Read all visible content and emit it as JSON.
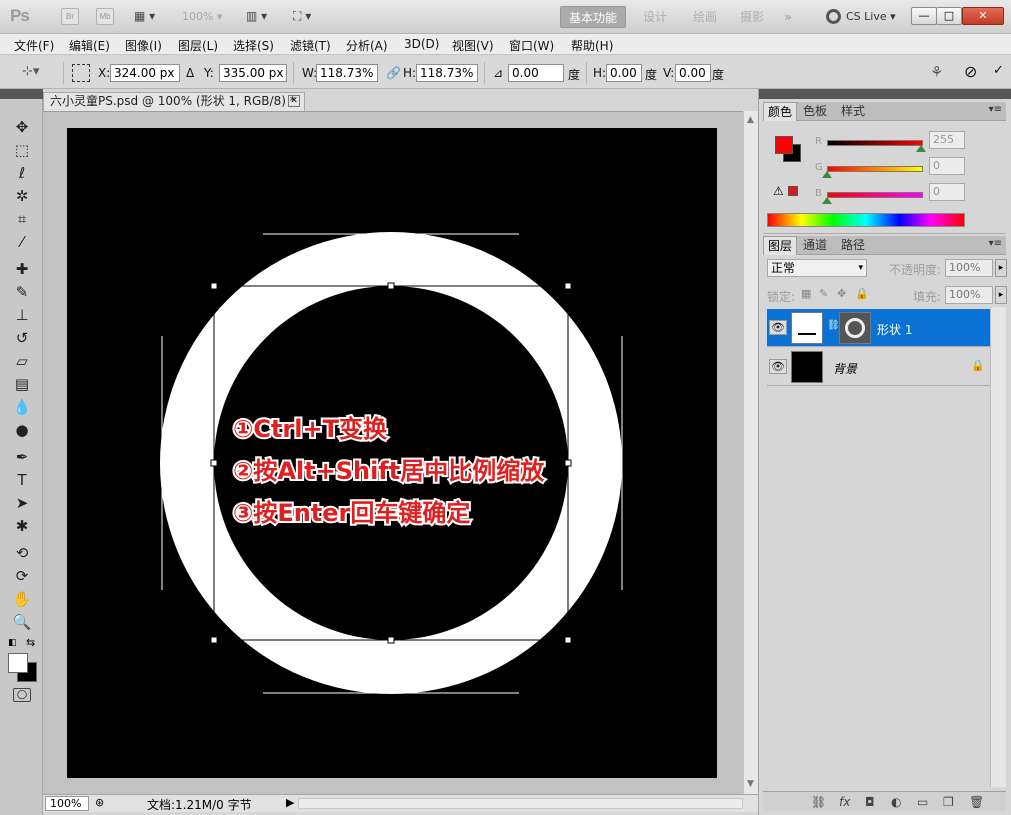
{
  "app": {
    "logo": "Ps",
    "badges": [
      "Br",
      "Mb"
    ],
    "zoom": "100%"
  },
  "workspaces": [
    "基本功能",
    "设计",
    "绘画",
    "摄影",
    "»"
  ],
  "cs_live": "CS Live",
  "window_buttons": {
    "minimize": "—",
    "maximize": "□",
    "close": "✕"
  },
  "menu": [
    "文件(F)",
    "编辑(E)",
    "图像(I)",
    "图层(L)",
    "选择(S)",
    "滤镜(T)",
    "分析(A)",
    "3D(D)",
    "视图(V)",
    "窗口(W)",
    "帮助(H)"
  ],
  "options": {
    "x_label": "X:",
    "x_value": "324.00 px",
    "y_label": "Y:",
    "y_value": "335.00 px",
    "w_label": "W:",
    "w_value": "118.73%",
    "h_label": "H:",
    "h_value": "118.73%",
    "angle_value": "0.00",
    "angle_unit": "度",
    "hskew_label": "H:",
    "hskew_value": "0.00",
    "hskew_unit": "度",
    "vskew_label": "V:",
    "vskew_value": "0.00",
    "vskew_unit": "度"
  },
  "document": {
    "tab_title": "六小灵童PS.psd @ 100% (形状 1, RGB/8) *",
    "zoom": "100%",
    "info": "文档:1.21M/0 字节"
  },
  "annotations": [
    "①Ctrl+T变换",
    "②按Alt+Shift居中比例缩放",
    "③按Enter回车键确定"
  ],
  "color_panel": {
    "tabs": [
      "颜色",
      "色板",
      "样式"
    ],
    "r": "255",
    "g": "0",
    "b": "0",
    "fg_color": "#ff0000",
    "bg_color": "#000000"
  },
  "layers_panel": {
    "tabs": [
      "图层",
      "通道",
      "路径"
    ],
    "blend_mode": "正常",
    "opacity_label": "不透明度:",
    "opacity": "100%",
    "lock_label": "锁定:",
    "fill_label": "填充:",
    "fill": "100%",
    "layers": [
      {
        "name": "形状 1",
        "selected": true
      },
      {
        "name": "背景",
        "locked": true
      }
    ]
  },
  "colors": {
    "accent": "#0a72d5",
    "annotation_text": "#e02020"
  }
}
